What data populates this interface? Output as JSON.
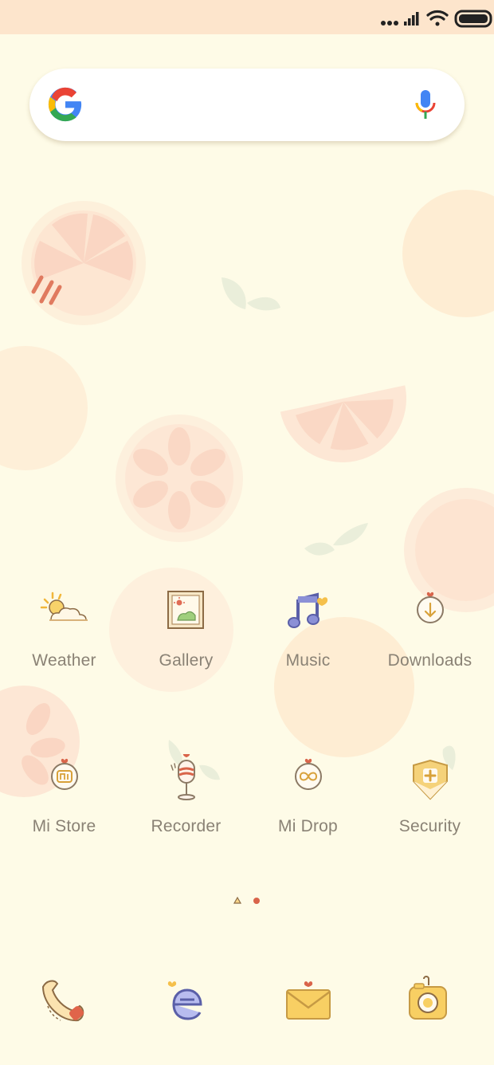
{
  "status_bar": {
    "icons": [
      "dots-icon",
      "signal-icon",
      "wifi-icon",
      "battery-icon"
    ]
  },
  "search": {
    "logo": "google-logo",
    "voice_icon": "mic-icon"
  },
  "apps": [
    {
      "label": "Weather",
      "icon": "weather-icon"
    },
    {
      "label": "Gallery",
      "icon": "gallery-icon"
    },
    {
      "label": "Music",
      "icon": "music-icon"
    },
    {
      "label": "Downloads",
      "icon": "downloads-icon"
    },
    {
      "label": "Mi Store",
      "icon": "mi-store-icon"
    },
    {
      "label": "Recorder",
      "icon": "recorder-icon"
    },
    {
      "label": "Mi Drop",
      "icon": "mi-drop-icon"
    },
    {
      "label": "Security",
      "icon": "security-icon"
    }
  ],
  "page_indicator": {
    "pages": 2,
    "current": 2
  },
  "dock": [
    {
      "icon": "phone-icon"
    },
    {
      "icon": "browser-icon"
    },
    {
      "icon": "messages-icon"
    },
    {
      "icon": "camera-icon"
    }
  ],
  "colors": {
    "background": "#fefbe7",
    "status_bar": "#fde5cc",
    "label": "#8a8275",
    "accent_red": "#d9644a"
  }
}
